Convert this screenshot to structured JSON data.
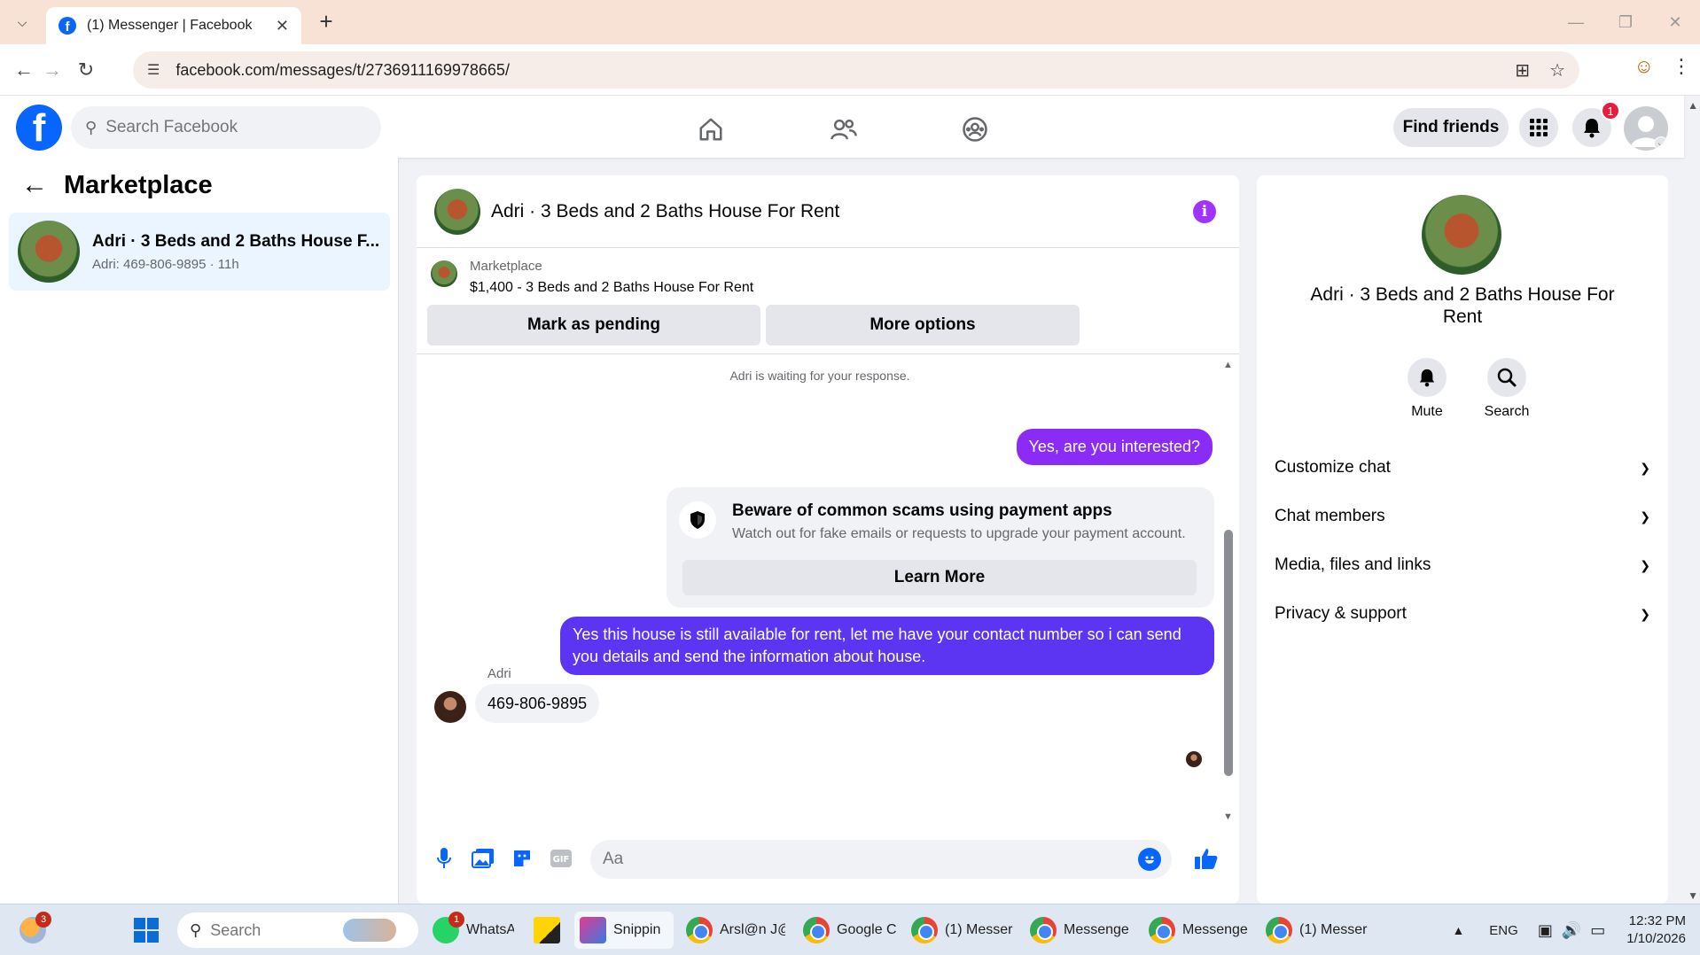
{
  "browser": {
    "tab_title": "(1) Messenger | Facebook",
    "url": "facebook.com/messages/t/2736911169978665/"
  },
  "fb": {
    "search_placeholder": "Search Facebook",
    "find_friends": "Find friends",
    "notification_count": "1"
  },
  "sidebar": {
    "title": "Marketplace",
    "conversations": [
      {
        "name": "Adri · 3 Beds and 2 Baths House F...",
        "subtitle": "Adri: 469-806-9895 · 11h"
      }
    ]
  },
  "chat": {
    "title": "Adri · 3 Beds and 2 Baths House For Rent",
    "listing": {
      "label": "Marketplace",
      "price_title": "$1,400 - 3 Beds and 2 Baths House For Rent",
      "mark_pending": "Mark as pending",
      "more_options": "More options"
    },
    "waiting_notice": "Adri is waiting for your response.",
    "messages": {
      "out1": "Yes, are you interested?",
      "out2": "Yes this house is still available for rent, let me have your contact number so i can send you details and send the information about house.",
      "in_sender": "Adri",
      "in1": "469-806-9895"
    },
    "scam_warning": {
      "title": "Beware of common scams using payment apps",
      "description": "Watch out for fake emails or requests to upgrade your payment account.",
      "button": "Learn More"
    },
    "composer": {
      "placeholder": "Aa"
    }
  },
  "details": {
    "title": "Adri · 3 Beds and 2 Baths House For Rent",
    "actions": [
      "Mute",
      "Search"
    ],
    "sections": [
      "Customize chat",
      "Chat members",
      "Media, files and links",
      "Privacy & support"
    ]
  },
  "taskbar": {
    "weather_badge": "3",
    "search_placeholder": "Search",
    "items": [
      {
        "label": "WhatsA",
        "badge": "1"
      },
      {
        "label": ""
      },
      {
        "label": "Snippin"
      },
      {
        "label": "Arsl@n J@"
      },
      {
        "label": "Google C"
      },
      {
        "label": "(1) Messer"
      },
      {
        "label": "Messenge"
      },
      {
        "label": "Messenge"
      },
      {
        "label": "(1) Messer"
      }
    ],
    "language": "ENG",
    "time": "12:32 PM",
    "date": "1/10/2026"
  },
  "colors": {
    "fb_blue": "#0866ff",
    "outgoing_bubble_1": "#8a2cf5",
    "outgoing_bubble_2": "#5b35f2",
    "info_purple": "#a033ff"
  }
}
